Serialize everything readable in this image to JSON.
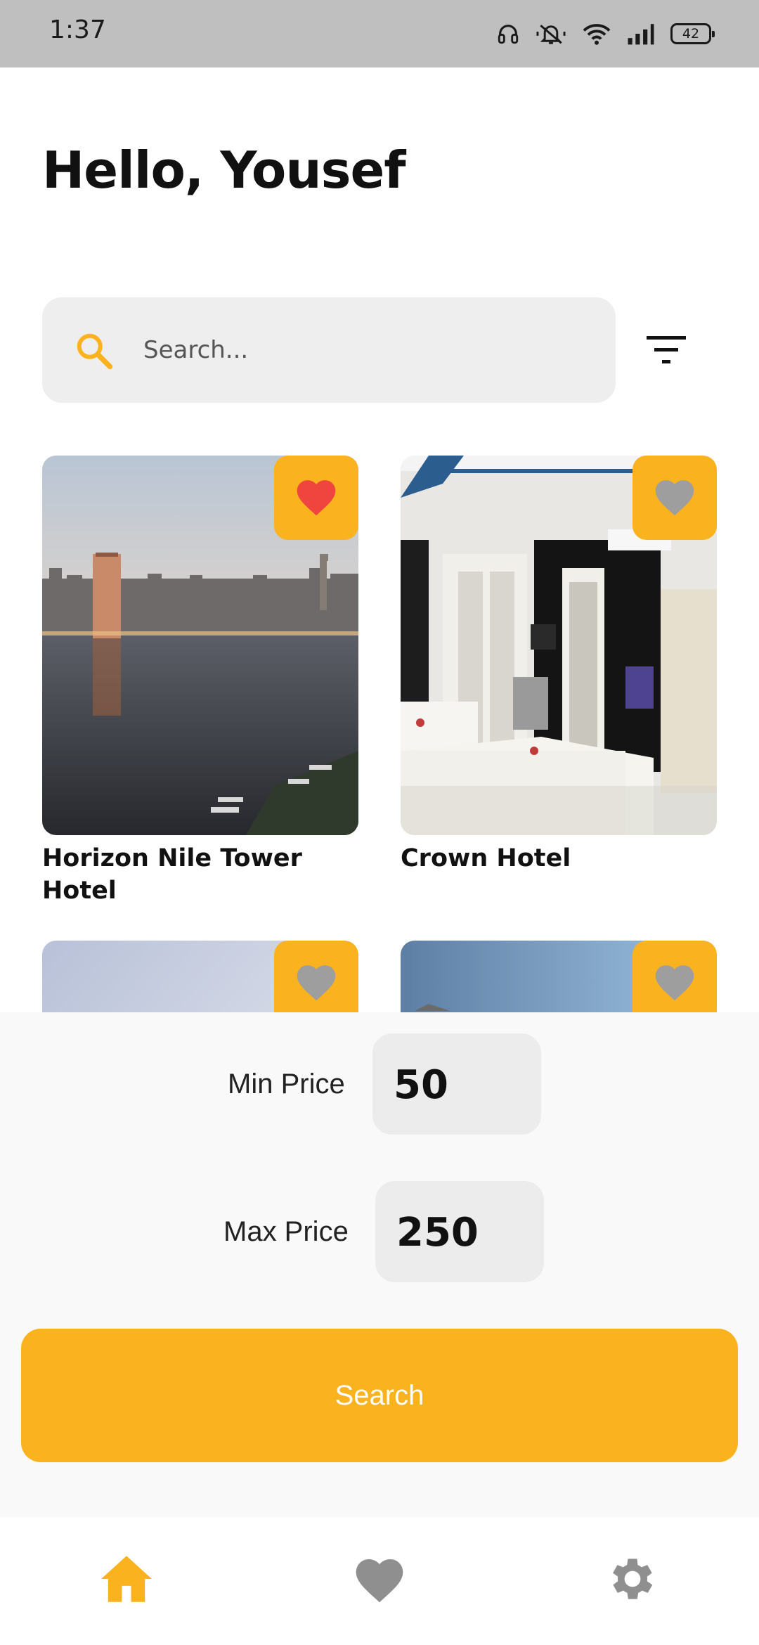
{
  "status_bar": {
    "time": "1:37",
    "battery": "42",
    "icons": [
      "headphones-icon",
      "silent-icon",
      "wifi-icon",
      "signal-icon",
      "battery-icon"
    ]
  },
  "greeting": "Hello, Yousef",
  "search": {
    "placeholder": "Search...",
    "value": ""
  },
  "hotels": [
    {
      "name": "Horizon Nile Tower Hotel",
      "favorite": true
    },
    {
      "name": "Crown Hotel",
      "favorite": false
    },
    {
      "name": "",
      "favorite": false
    },
    {
      "name": "",
      "favorite": false
    }
  ],
  "filter": {
    "min_label": "Min Price",
    "min_value": "50",
    "max_label": "Max Price",
    "max_value": "250",
    "button_label": "Search"
  },
  "nav": {
    "items": [
      "home-icon",
      "favorites-icon",
      "settings-icon"
    ],
    "active": "home-icon"
  },
  "colors": {
    "accent": "#FBB21F",
    "favorite_active": "#F0453F",
    "favorite_inactive": "#9E9E9E",
    "nav_inactive": "#8F8F8F"
  }
}
